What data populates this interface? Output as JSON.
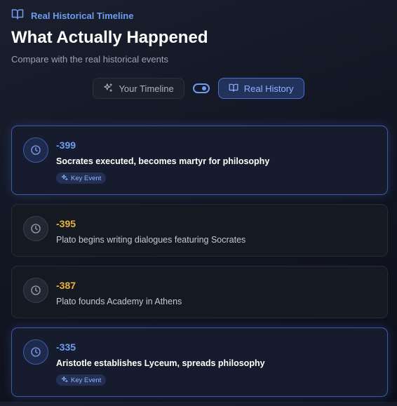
{
  "header": {
    "brand_icon": "book-open-icon",
    "brand_label": "Real Historical Timeline",
    "title": "What Actually Happened",
    "subtitle": "Compare with the real historical events"
  },
  "toggle": {
    "your_timeline_label": "Your Timeline",
    "your_timeline_icon": "sparkles-icon",
    "switch_icon": "toggle-switch-icon",
    "real_history_label": "Real History",
    "real_history_icon": "book-open-icon",
    "active": "Real History"
  },
  "events": [
    {
      "year": "-399",
      "description": "Socrates executed, becomes martyr for philosophy",
      "key_event": true,
      "badge": "Key Event"
    },
    {
      "year": "-395",
      "description": "Plato begins writing dialogues featuring Socrates",
      "key_event": false
    },
    {
      "year": "-387",
      "description": "Plato founds Academy in Athens",
      "key_event": false
    },
    {
      "year": "-335",
      "description": "Aristotle establishes Lyceum, spreads philosophy",
      "key_event": true,
      "badge": "Key Event"
    }
  ],
  "colors": {
    "accent": "#6f9cf0",
    "year_normal": "#eab33c",
    "background": "#111522"
  }
}
